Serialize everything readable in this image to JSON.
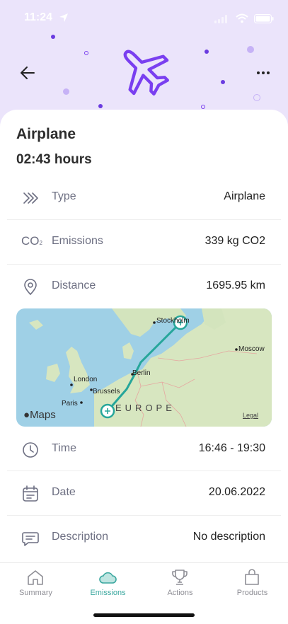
{
  "status": {
    "time": "11:24"
  },
  "header": {
    "title": "Airplane",
    "duration": "02:43 hours"
  },
  "colors": {
    "accent": "#7a3ff0",
    "hero_bg": "#ebe4fb",
    "teal": "#3aa79f"
  },
  "details": [
    {
      "key": "type",
      "icon": "chevrons-icon",
      "label": "Type",
      "value": "Airplane"
    },
    {
      "key": "emissions",
      "icon": "co2-icon",
      "label": "Emissions",
      "value": "339 kg CO2"
    },
    {
      "key": "distance",
      "icon": "location-pin-icon",
      "label": "Distance",
      "value": "1695.95 km"
    },
    {
      "key": "time",
      "icon": "clock-icon",
      "label": "Time",
      "value": "16:46 - 19:30"
    },
    {
      "key": "date",
      "icon": "calendar-icon",
      "label": "Date",
      "value": "20.06.2022"
    },
    {
      "key": "description",
      "icon": "message-icon",
      "label": "Description",
      "value": "No description"
    }
  ],
  "icons": {
    "co2_text": "CO"
  },
  "map": {
    "cities": [
      "Stockholm",
      "Moscow",
      "Berlin",
      "London",
      "Brussels",
      "Paris"
    ],
    "region": "EUROPE",
    "brand": "Maps",
    "legal": "Legal"
  },
  "tabs": [
    {
      "label": "Summary",
      "icon": "home-icon",
      "active": false
    },
    {
      "label": "Emissions",
      "icon": "cloud-icon",
      "active": true
    },
    {
      "label": "Actions",
      "icon": "trophy-icon",
      "active": false
    },
    {
      "label": "Products",
      "icon": "shopping-bag-icon",
      "active": false
    }
  ]
}
